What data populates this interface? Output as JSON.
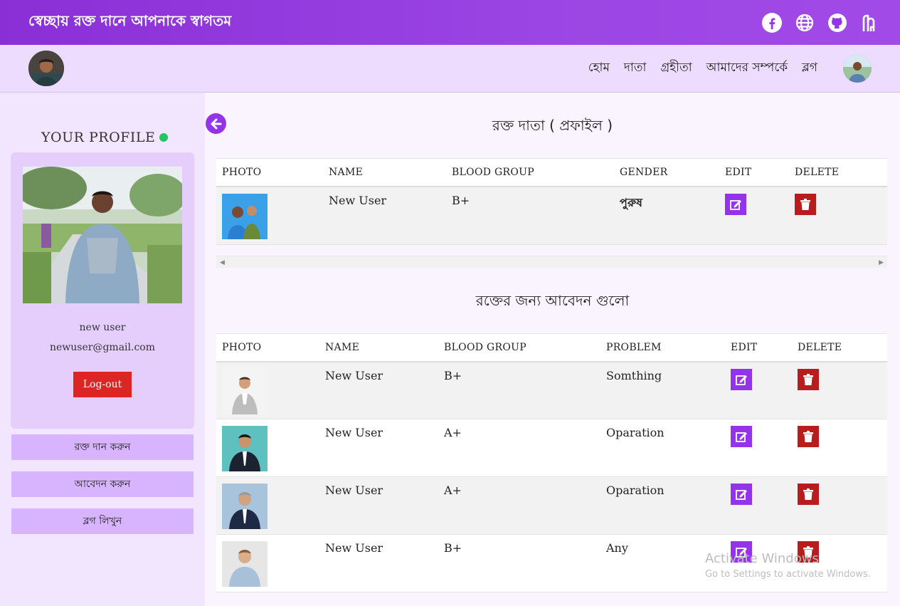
{
  "header": {
    "welcome": "স্বেচ্ছায় রক্ত দানে আপনাকে স্বাগতম",
    "social_icons": [
      "facebook-icon",
      "globe-icon",
      "github-icon",
      "hashnode-icon"
    ]
  },
  "nav": {
    "links": [
      "হোম",
      "দাতা",
      "গ্রহীতা",
      "আমাদের সম্পর্কে",
      "ব্লগ"
    ]
  },
  "sidebar": {
    "profile_title": "YOUR PROFILE",
    "name": "new user",
    "email": "newuser@gmail.com",
    "logout_label": "Log-out",
    "buttons": [
      "রক্ত দান করুন",
      "আবেদন করুন",
      "ব্লগ লিখুন"
    ]
  },
  "donors": {
    "title": "রক্ত দাতা ( প্রফাইল )",
    "columns": [
      "PHOTO",
      "NAME",
      "BLOOD GROUP",
      "GENDER",
      "EDIT",
      "DELETE"
    ],
    "rows": [
      {
        "name": "New User",
        "blood_group": "B+",
        "gender": "পুরুষ"
      }
    ]
  },
  "requests": {
    "title": "রক্তের জন্য আবেদন গুলো",
    "columns": [
      "PHOTO",
      "NAME",
      "BLOOD GROUP",
      "PROBLEM",
      "EDIT",
      "DELETE"
    ],
    "rows": [
      {
        "name": "New User",
        "blood_group": "B+",
        "problem": "Somthing"
      },
      {
        "name": "New User",
        "blood_group": "A+",
        "problem": "Oparation"
      },
      {
        "name": "New User",
        "blood_group": "A+",
        "problem": "Oparation"
      },
      {
        "name": "New User",
        "blood_group": "B+",
        "problem": "Any"
      }
    ]
  },
  "watermark": {
    "line1": "Activate Windows",
    "line2": "Go to Settings to activate Windows."
  },
  "colors": {
    "header": "#9333ea",
    "nav_bg": "#eedcff",
    "edit": "#9333ea",
    "delete": "#b91c1c",
    "logout": "#dc2626",
    "online": "#22c55e"
  }
}
